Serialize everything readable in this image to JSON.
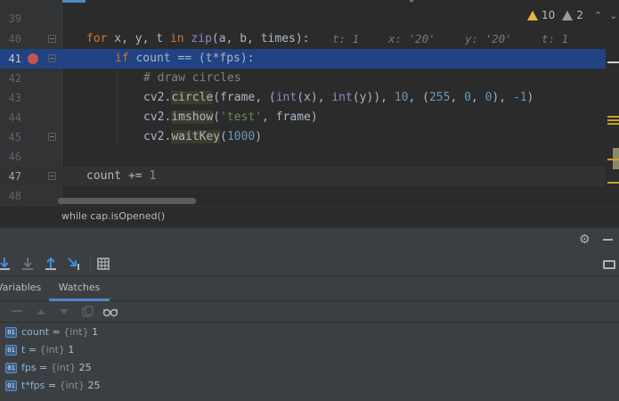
{
  "editor": {
    "lines": [
      {
        "num": "39"
      },
      {
        "num": "40",
        "hint_t": "t: 1",
        "hint_x": "x: '20'",
        "hint_y": "y: '20'",
        "hint_t2": "t: 1"
      },
      {
        "num": "41"
      },
      {
        "num": "42",
        "comment": "# draw circles"
      },
      {
        "num": "43"
      },
      {
        "num": "44"
      },
      {
        "num": "45"
      },
      {
        "num": "46"
      },
      {
        "num": "47"
      },
      {
        "num": "48"
      }
    ],
    "code": {
      "l40": {
        "kw_for": "for",
        "vars": " x, y, t ",
        "kw_in": "in",
        "sp": " ",
        "fn_zip": "zip",
        "args": "(a, b, times):"
      },
      "l41": {
        "kw_if": "if",
        "cond": " count == (t*fps):"
      },
      "l43": {
        "obj": "cv2.",
        "fn": "circle",
        "a1": "(frame, (",
        "int1": "int",
        "a2": "(x), ",
        "int2": "int",
        "a3": "(y)), ",
        "n10": "10",
        "a4": ", (",
        "n255": "255",
        "a5": ", ",
        "n0a": "0",
        "a6": ", ",
        "n0b": "0",
        "a7": "), ",
        "nm1": "-1",
        "a8": ")"
      },
      "l44": {
        "obj": "cv2.",
        "fn": "imshow",
        "a1": "(",
        "str": "'test'",
        "a2": ", frame)"
      },
      "l45": {
        "obj": "cv2.",
        "fn": "waitKey",
        "a1": "(",
        "n": "1000",
        "a2": ")"
      },
      "l47": {
        "stmt": "count += ",
        "n": "1"
      }
    },
    "warnings": "10",
    "weak_warnings": "2",
    "breadcrumb": "while cap.isOpened()"
  },
  "debug": {
    "tabs": {
      "variables": "Variables",
      "watches": "Watches"
    },
    "watches": [
      {
        "icon": "01",
        "name": "count",
        "eq": " = ",
        "type": "{int}",
        "value": " 1"
      },
      {
        "icon": "01",
        "name": "t",
        "eq": " = ",
        "type": "{int}",
        "value": " 1"
      },
      {
        "icon": "01",
        "name": "fps",
        "eq": " = ",
        "type": "{int}",
        "value": " 25"
      },
      {
        "icon": "01",
        "name": "t*fps",
        "eq": " = ",
        "type": "{int}",
        "value": " 25"
      }
    ]
  },
  "colors": {
    "accent": "#4a88c7",
    "breakpoint": "#c75450",
    "current_line": "#214283",
    "warning": "#e6b73f"
  }
}
